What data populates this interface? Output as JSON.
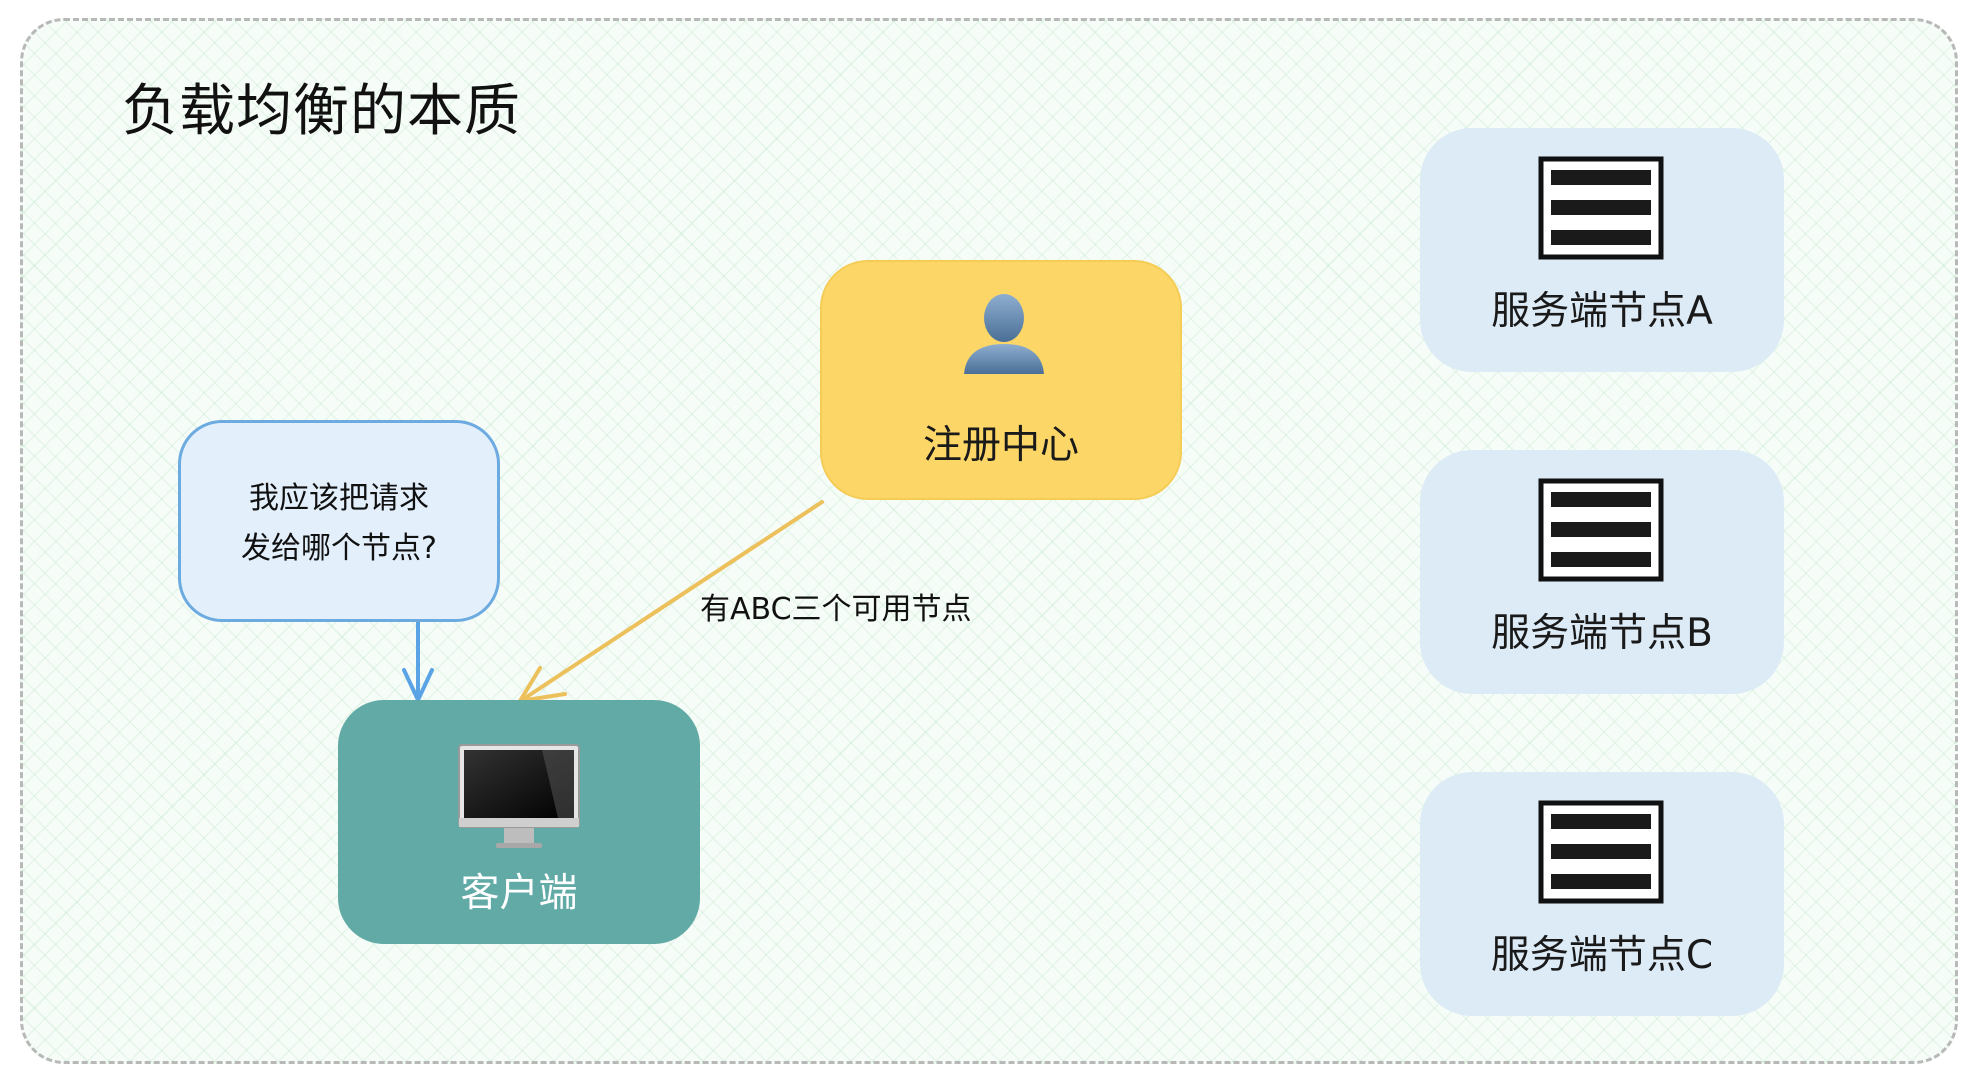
{
  "diagram": {
    "title": "负载均衡的本质",
    "registry": {
      "label": "注册中心",
      "icon": "user-icon"
    },
    "client": {
      "label": "客户端",
      "icon": "monitor-icon"
    },
    "bubble": {
      "line1": "我应该把请求",
      "line2": "发给哪个节点?"
    },
    "edge_label": "有ABC三个可用节点",
    "servers": [
      {
        "label": "服务端节点A",
        "icon": "server-icon"
      },
      {
        "label": "服务端节点B",
        "icon": "server-icon"
      },
      {
        "label": "服务端节点C",
        "icon": "server-icon"
      }
    ]
  },
  "colors": {
    "registry": "#fcd768",
    "client": "#61aaa6",
    "bubble": "#e3f0fc",
    "bubble_border": "#6caae0",
    "server": "#dcebf6",
    "arrow_registry": "#ecc05a",
    "arrow_bubble": "#5aa4e6"
  }
}
